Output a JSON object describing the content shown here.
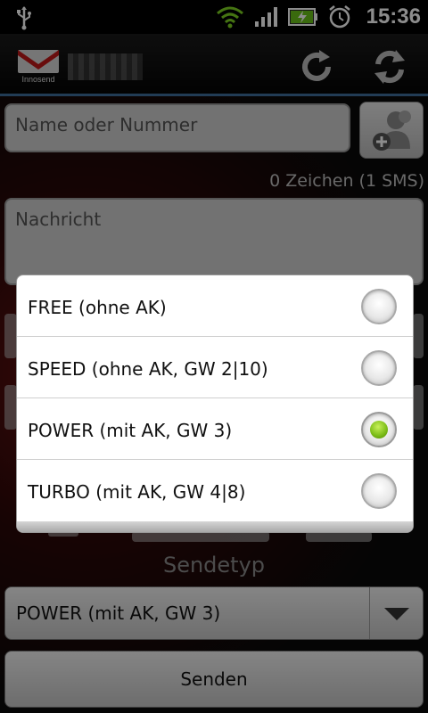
{
  "status_bar": {
    "time": "15:36",
    "icons": [
      "usb-icon",
      "wifi-icon",
      "signal-icon",
      "battery-charging-icon",
      "alarm-icon"
    ]
  },
  "title_bar": {
    "logo_text": "Innosend",
    "icons": [
      "refresh-balance-icon",
      "sync-icon"
    ]
  },
  "form": {
    "recipient_placeholder": "Name oder Nummer",
    "char_counter": "0 Zeichen (1 SMS)",
    "message_placeholder": "Nachricht",
    "sendetyp_label": "Sendetyp",
    "sendetyp_value": "POWER (mit AK, GW 3)",
    "send_label": "Senden"
  },
  "dialog": {
    "options": [
      {
        "label": "FREE (ohne AK)",
        "selected": false
      },
      {
        "label": "SPEED (ohne AK, GW 2|10)",
        "selected": false
      },
      {
        "label": "POWER (mit AK, GW 3)",
        "selected": true
      },
      {
        "label": "TURBO (mit AK, GW 4|8)",
        "selected": false
      }
    ]
  },
  "colors": {
    "accent_line": "#3f6e9c",
    "radio_selected": "#7fbf1a"
  }
}
